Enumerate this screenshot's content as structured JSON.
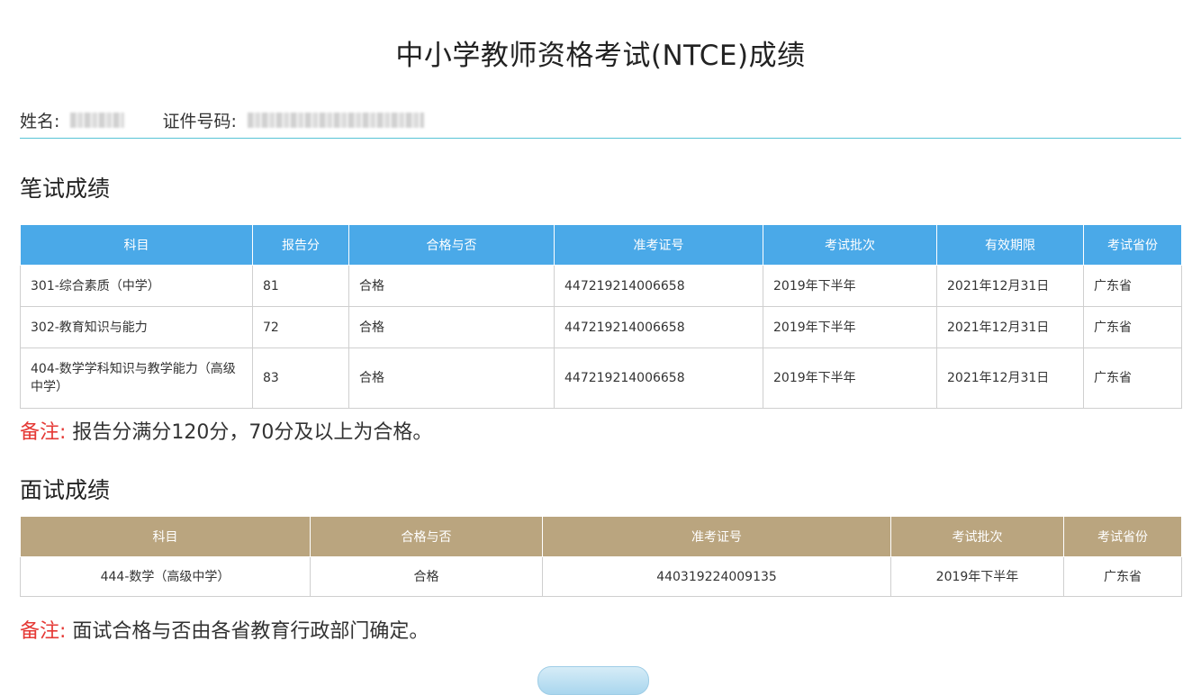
{
  "page": {
    "title": "中小学教师资格考试(NTCE)成绩"
  },
  "identity": {
    "name_label": "姓名:",
    "id_label": "证件号码:"
  },
  "written": {
    "title": "笔试成绩",
    "header_color": "#4aa9e8",
    "headers": [
      "科目",
      "报告分",
      "合格与否",
      "准考证号",
      "考试批次",
      "有效期限",
      "考试省份"
    ],
    "rows": [
      [
        "301-综合素质（中学）",
        "81",
        "合格",
        "447219214006658",
        "2019年下半年",
        "2021年12月31日",
        "广东省"
      ],
      [
        "302-教育知识与能力",
        "72",
        "合格",
        "447219214006658",
        "2019年下半年",
        "2021年12月31日",
        "广东省"
      ],
      [
        "404-数学学科知识与教学能力（高级中学）",
        "83",
        "合格",
        "447219214006658",
        "2019年下半年",
        "2021年12月31日",
        "广东省"
      ]
    ],
    "note_label": "备注:",
    "note_text": " 报告分满分120分，70分及以上为合格。"
  },
  "interview": {
    "title": "面试成绩",
    "header_color": "#baa57f",
    "headers": [
      "科目",
      "合格与否",
      "准考证号",
      "考试批次",
      "考试省份"
    ],
    "rows": [
      [
        "444-数学（高级中学）",
        "合格",
        "440319224009135",
        "2019年下半年",
        "广东省"
      ]
    ],
    "note_label": "备注:",
    "note_text": " 面试合格与否由各省教育行政部门确定。"
  },
  "colors": {
    "note_label": "#e53935",
    "divider": "#57c3d6"
  }
}
